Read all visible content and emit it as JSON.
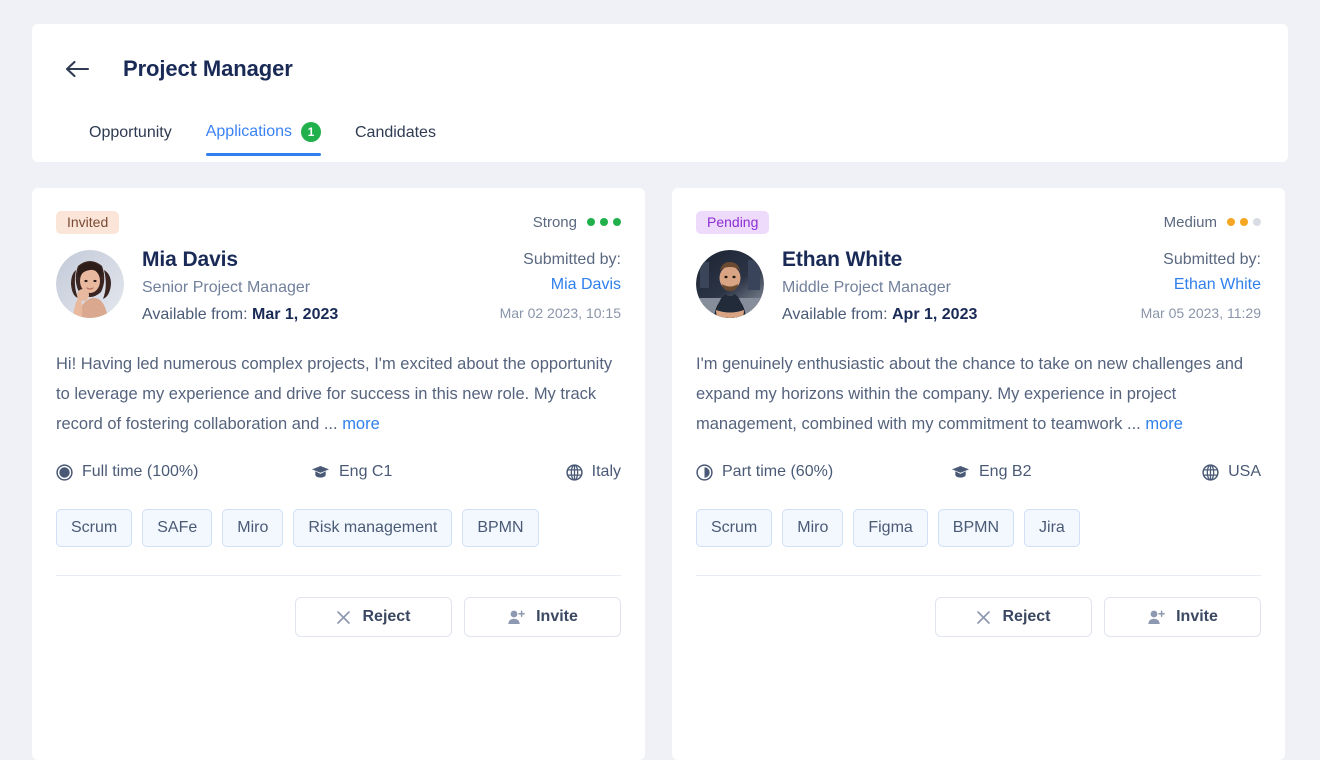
{
  "header": {
    "back_icon": "arrow-left-icon",
    "title": "Project Manager",
    "tabs": [
      {
        "label": "Opportunity",
        "active": false,
        "badge": null
      },
      {
        "label": "Applications",
        "active": true,
        "badge": "1"
      },
      {
        "label": "Candidates",
        "active": false,
        "badge": null
      }
    ]
  },
  "cards": [
    {
      "status": "Invited",
      "status_style": "invited",
      "status_bg": "#fae5d8",
      "status_fg": "#7a4a33",
      "rating_label": "Strong",
      "rating_filled": 3,
      "rating_total": 3,
      "rating_color": "#21b04b",
      "avatar": "avatar-mia-davis",
      "name": "Mia Davis",
      "role": "Senior Project Manager",
      "available_label": "Available from:",
      "available_value": "Mar 1, 2023",
      "submitted_label": "Submitted by:",
      "submitted_by": "Mia Davis",
      "submitted_date": "Mar 02 2023, 10:15",
      "description": "Hi! Having led numerous complex projects, I'm excited about the opportunity to leverage my experience and drive for success in this new role. My track record of fostering collaboration and ...",
      "more_label": "more",
      "employment_icon": "clock-full-icon",
      "employment": "Full time (100%)",
      "language_icon": "graduation-cap-icon",
      "language": "Eng C1",
      "location_icon": "globe-icon",
      "location": "Italy",
      "skills": [
        "Scrum",
        "SAFe",
        "Miro",
        "Risk management",
        "BPMN"
      ],
      "reject_label": "Reject",
      "invite_label": "Invite"
    },
    {
      "status": "Pending",
      "status_style": "pending",
      "status_bg": "#eedafb",
      "status_fg": "#8c2fd4",
      "rating_label": "Medium",
      "rating_filled": 2,
      "rating_total": 3,
      "rating_color": "#f5a623",
      "avatar": "avatar-ethan-white",
      "name": "Ethan White",
      "role": "Middle Project Manager",
      "available_label": "Available from:",
      "available_value": "Apr 1, 2023",
      "submitted_label": "Submitted by:",
      "submitted_by": "Ethan White",
      "submitted_date": "Mar 05 2023, 11:29",
      "description": "I'm genuinely enthusiastic about the chance to take on new challenges and expand my horizons within the company. My experience in project management, combined with my commitment to teamwork ...",
      "more_label": "more",
      "employment_icon": "clock-part-icon",
      "employment": "Part time (60%)",
      "language_icon": "graduation-cap-icon",
      "language": "Eng B2",
      "location_icon": "globe-icon",
      "location": "USA",
      "skills": [
        "Scrum",
        "Miro",
        "Figma",
        "BPMN",
        "Jira"
      ],
      "reject_label": "Reject",
      "invite_label": "Invite"
    }
  ],
  "colors": {
    "page_bg": "#eff1f6",
    "card_bg": "#ffffff",
    "accent_blue": "#2f80ed",
    "title_navy": "#192a56",
    "badge_green": "#21b04b"
  }
}
